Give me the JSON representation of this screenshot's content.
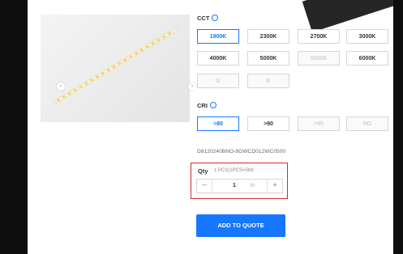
{
  "product": {
    "image_alt": "LED strip",
    "prev_icon": "chevron-left-icon",
    "next_icon": "chevron-right-icon"
  },
  "cct": {
    "label": "CCT",
    "options": [
      {
        "label": "1900K",
        "state": "selected"
      },
      {
        "label": "2300K",
        "state": "normal"
      },
      {
        "label": "2700K",
        "state": "normal"
      },
      {
        "label": "3000K",
        "state": "normal"
      },
      {
        "label": "4000K",
        "state": "normal"
      },
      {
        "label": "5000K",
        "state": "normal"
      },
      {
        "label": "5800K",
        "state": "disabled"
      },
      {
        "label": "6000K",
        "state": "normal"
      },
      {
        "label": "G",
        "state": "disabled"
      },
      {
        "label": "B",
        "state": "disabled"
      }
    ]
  },
  "cri": {
    "label": "CRI",
    "options": [
      {
        "label": ">80",
        "state": "selected"
      },
      {
        "label": ">90",
        "state": "normal"
      },
      {
        "label": ">95",
        "state": "disabled"
      },
      {
        "label": "NO",
        "state": "disabled"
      }
    ]
  },
  "sku": "D8120240BNO-8GWCD012WC0500",
  "qty": {
    "label": "Qty",
    "note": "1 PCS(1PCS=5M)",
    "value": "1",
    "unit": "M",
    "minus": "−",
    "plus": "+"
  },
  "actions": {
    "add_to_quote": "ADD TO QUOTE"
  },
  "colors": {
    "accent": "#1677ff",
    "highlight": "#d42a2a"
  }
}
